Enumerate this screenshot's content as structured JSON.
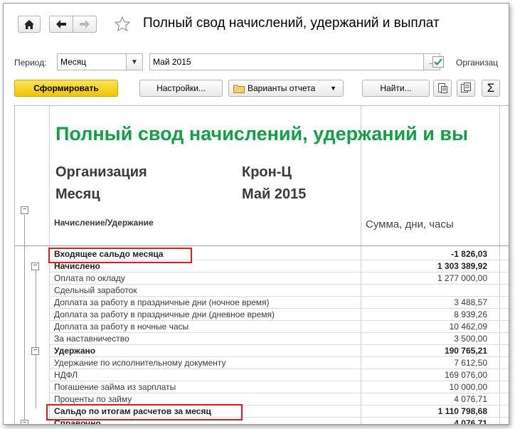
{
  "window": {
    "title": "Полный свод начислений, удержаний и выплат"
  },
  "filters": {
    "period_label": "Период:",
    "period_value": "Месяц",
    "month_value": "Май 2015",
    "ellipsis": "...",
    "org_label": "Организац"
  },
  "toolbar": {
    "generate": "Сформировать",
    "settings": "Настройки...",
    "variants": "Варианты отчета",
    "find": "Найти...",
    "sum_symbol": "Σ"
  },
  "report": {
    "title": "Полный свод начислений, удержаний и вы",
    "org_label": "Организация",
    "org_value": "Крон-Ц",
    "month_label": "Месяц",
    "month_value": "Май 2015",
    "col_name": "Начисление/Удержание",
    "col_value": "Сумма, дни, часы",
    "rows": [
      {
        "name": "Входящее сальдо месяца",
        "value": "-1 826,03"
      },
      {
        "name": "Начислено",
        "value": "1 303 389,92"
      },
      {
        "name": "Оплата по окладу",
        "value": "1 277 000,00"
      },
      {
        "name": "Сдельный заработок",
        "value": ""
      },
      {
        "name": "Доплата за работу в праздничные дни (ночное время)",
        "value": "3 488,57"
      },
      {
        "name": "Доплата за работу в праздничные дни (дневное время)",
        "value": "8 939,26"
      },
      {
        "name": "Доплата за работу в ночные часы",
        "value": "10 462,09"
      },
      {
        "name": "За наставничество",
        "value": "3 500,00"
      },
      {
        "name": "Удержано",
        "value": "190 765,21"
      },
      {
        "name": "Удержание по исполнительному документу",
        "value": "7 612,50"
      },
      {
        "name": "НДФЛ",
        "value": "169 076,00"
      },
      {
        "name": "Погашение займа из зарплаты",
        "value": "10 000,00"
      },
      {
        "name": "Проценты по займу",
        "value": "4 076,71"
      },
      {
        "name": "Сальдо по итогам расчетов за месяц",
        "value": "1 110 798,68"
      },
      {
        "name": "Справочно",
        "value": "4 076,71"
      }
    ]
  },
  "colors": {
    "title_green": "#11a046",
    "highlight_red": "#e01b1b",
    "primary_button": "#f2c500"
  },
  "icons": [
    "home-icon",
    "back-arrow-icon",
    "forward-arrow-icon",
    "star-icon",
    "dropdown-arrow-icon",
    "checkbox-checked-icon",
    "variants-folder-icon",
    "save-report-icon",
    "print-report-icon",
    "sum-icon",
    "collapse-icon"
  ]
}
